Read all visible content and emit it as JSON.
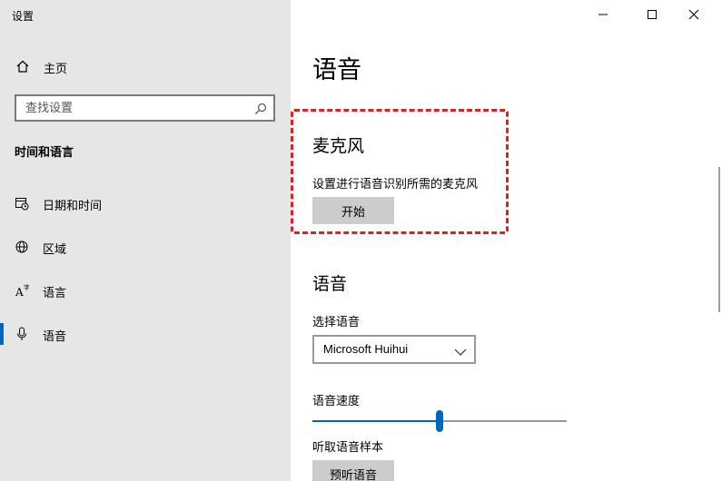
{
  "window": {
    "title": "设置"
  },
  "sidebar": {
    "home_label": "主页",
    "search_placeholder": "查找设置",
    "section_heading": "时间和语言",
    "items": [
      {
        "label": "日期和时间",
        "icon": "calendar-clock-icon",
        "active": false
      },
      {
        "label": "区域",
        "icon": "globe-icon",
        "active": false
      },
      {
        "label": "语言",
        "icon": "language-icon",
        "active": false
      },
      {
        "label": "语音",
        "icon": "microphone-icon",
        "active": true
      }
    ]
  },
  "main": {
    "page_title": "语音",
    "microphone": {
      "heading": "麦克风",
      "description": "设置进行语音识别所需的麦克风",
      "button_label": "开始"
    },
    "voice": {
      "heading": "语音",
      "select_label": "选择语音",
      "selected_voice": "Microsoft Huihui",
      "speed_label": "语音速度",
      "speed_value": 0.5,
      "sample_label": "听取语音样本",
      "preview_button": "预听语音"
    }
  },
  "colors": {
    "accent": "#0067c0",
    "highlight": "#e02020",
    "sidebar_bg": "#e6e6e6"
  }
}
